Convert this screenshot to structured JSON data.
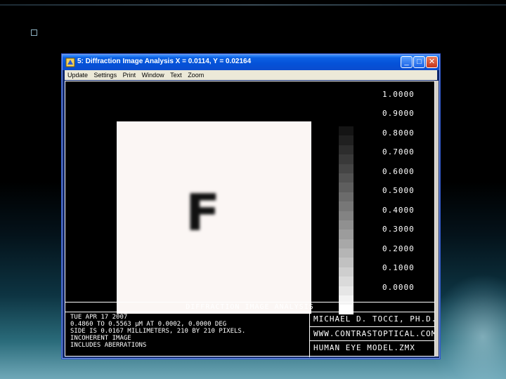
{
  "slide": {
    "bullet_icon": "square-bullet-icon"
  },
  "window": {
    "title": "5: Diffraction Image Analysis X = 0.0114, Y = 0.02164",
    "app_icon": "zemax-icon",
    "minimize_label": "_",
    "maximize_label": "□",
    "close_label": "✕"
  },
  "menu": [
    {
      "label": "Update"
    },
    {
      "label": "Settings"
    },
    {
      "label": "Print"
    },
    {
      "label": "Window"
    },
    {
      "label": "Text"
    },
    {
      "label": "Zoom"
    }
  ],
  "image": {
    "letter": "F"
  },
  "scale": {
    "labels": [
      "1.0000",
      "0.9000",
      "0.8000",
      "0.7000",
      "0.6000",
      "0.5000",
      "0.4000",
      "0.3000",
      "0.2000",
      "0.1000",
      "0.0000"
    ]
  },
  "panel": {
    "title": "DIFFRACTION IMAGE ANALYSIS",
    "info": [
      "TUE APR 17 2007",
      "0.4860 TO 0.5563 µM AT 0.0002, 0.0000 DEG",
      "SIDE IS 0.0167 MILLIMETERS, 210 BY 210 PIXELS.",
      "INCOHERENT IMAGE",
      "INCLUDES ABERRATIONS"
    ],
    "author": "MICHAEL D. TOCCI, PH.D.",
    "website": "WWW.CONTRASTOPTICAL.COM",
    "file": "HUMAN EYE MODEL.ZMX"
  }
}
